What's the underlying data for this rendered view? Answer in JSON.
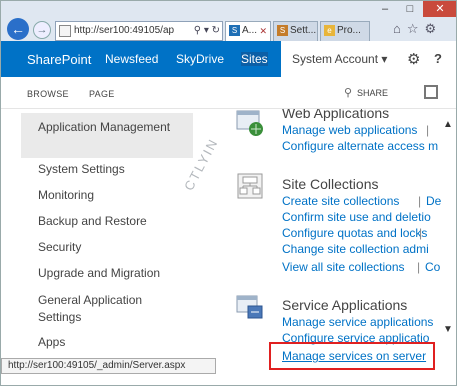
{
  "browser": {
    "address_url": "http://ser100:49105/ap",
    "tabs": [
      {
        "label": "A...",
        "active": true
      },
      {
        "label": "Sett...",
        "active": false
      },
      {
        "label": "Pro...",
        "active": false
      }
    ],
    "window_controls": {
      "minimize": "–",
      "maximize": "□",
      "close": "✕"
    }
  },
  "suite_bar": {
    "brand": "SharePoint",
    "links": [
      "Newsfeed",
      "SkyDrive",
      "Sites"
    ],
    "active_link": "Sites",
    "account": "System Account ▾",
    "accent_color": "#0072c6"
  },
  "ribbon": {
    "tabs": [
      "BROWSE",
      "PAGE"
    ],
    "share_label": "SHARE"
  },
  "left_nav": {
    "items": [
      "Application Management",
      "System Settings",
      "Monitoring",
      "Backup and Restore",
      "Security",
      "Upgrade and Migration",
      "General Application Settings",
      "Apps"
    ],
    "selected": "Application Management"
  },
  "sections": [
    {
      "title": "Web Applications",
      "icon": "web-applications-icon",
      "links": [
        "Manage web applications",
        "Configure alternate access m"
      ]
    },
    {
      "title": "Site Collections",
      "icon": "site-collections-icon",
      "links": [
        "Create site collections",
        "Dele",
        "Confirm site use and deletio",
        "Configure quotas and locks",
        "Change site collection admi",
        "View all site collections",
        "Co"
      ]
    },
    {
      "title": "Service Applications",
      "icon": "service-applications-icon",
      "links": [
        "Manage service applications",
        "Configure service applicatio",
        "Manage services on server"
      ]
    }
  ],
  "watermark": "CTLYIN",
  "status_bar_url": "http://ser100:49105/_admin/Server.aspx",
  "highlight_color": "#e02020"
}
